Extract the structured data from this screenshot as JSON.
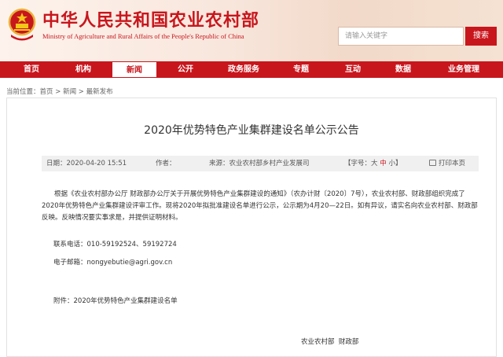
{
  "header": {
    "title": "中华人民共和国农业农村部",
    "subtitle": "Ministry of Agriculture and Rural Affairs of the People's Republic of China",
    "search_placeholder": "请输入关键字",
    "search_button": "搜索"
  },
  "nav": {
    "items": [
      "首页",
      "机构",
      "新闻",
      "公开",
      "政务服务",
      "专题",
      "互动",
      "数据",
      "业务管理"
    ],
    "active": "新闻"
  },
  "breadcrumb": {
    "prefix": "当前位置：",
    "items": [
      "首页",
      "新闻",
      "最新发布"
    ],
    "separator": " > "
  },
  "article": {
    "title": "2020年优势特色产业集群建设名单公示公告",
    "date_label": "日期：",
    "date": "2020-04-20 15:51",
    "author_label": "作者：",
    "author": "",
    "source_label": "来源：",
    "source": "农业农村部乡村产业发展司",
    "font_label": "【字号：",
    "font_large": "大",
    "font_medium": "中",
    "font_small": "小",
    "font_close": "】",
    "print_label": "打印本页",
    "paragraph": "根据《农业农村部办公厅 财政部办公厅关于开展优势特色产业集群建设的通知》（农办计财〔2020〕7号），农业农村部、财政部组织完成了2020年优势特色产业集群建设评审工作。现将2020年拟批准建设名单进行公示，公示期为4月20—22日。如有异议，请实名向农业农村部、财政部反映。反映情况要实事求是，并提供证明材料。",
    "phone": "联系电话：010-59192524、59192724",
    "email": "电子邮箱：nongyebutie@agri.gov.cn",
    "attachment": "附件：2020年优势特色产业集群建设名单",
    "signature": "农业农村部  财政部"
  },
  "colors": {
    "brand_red": "#c8161d",
    "meta_bg": "#f0f0f0"
  }
}
